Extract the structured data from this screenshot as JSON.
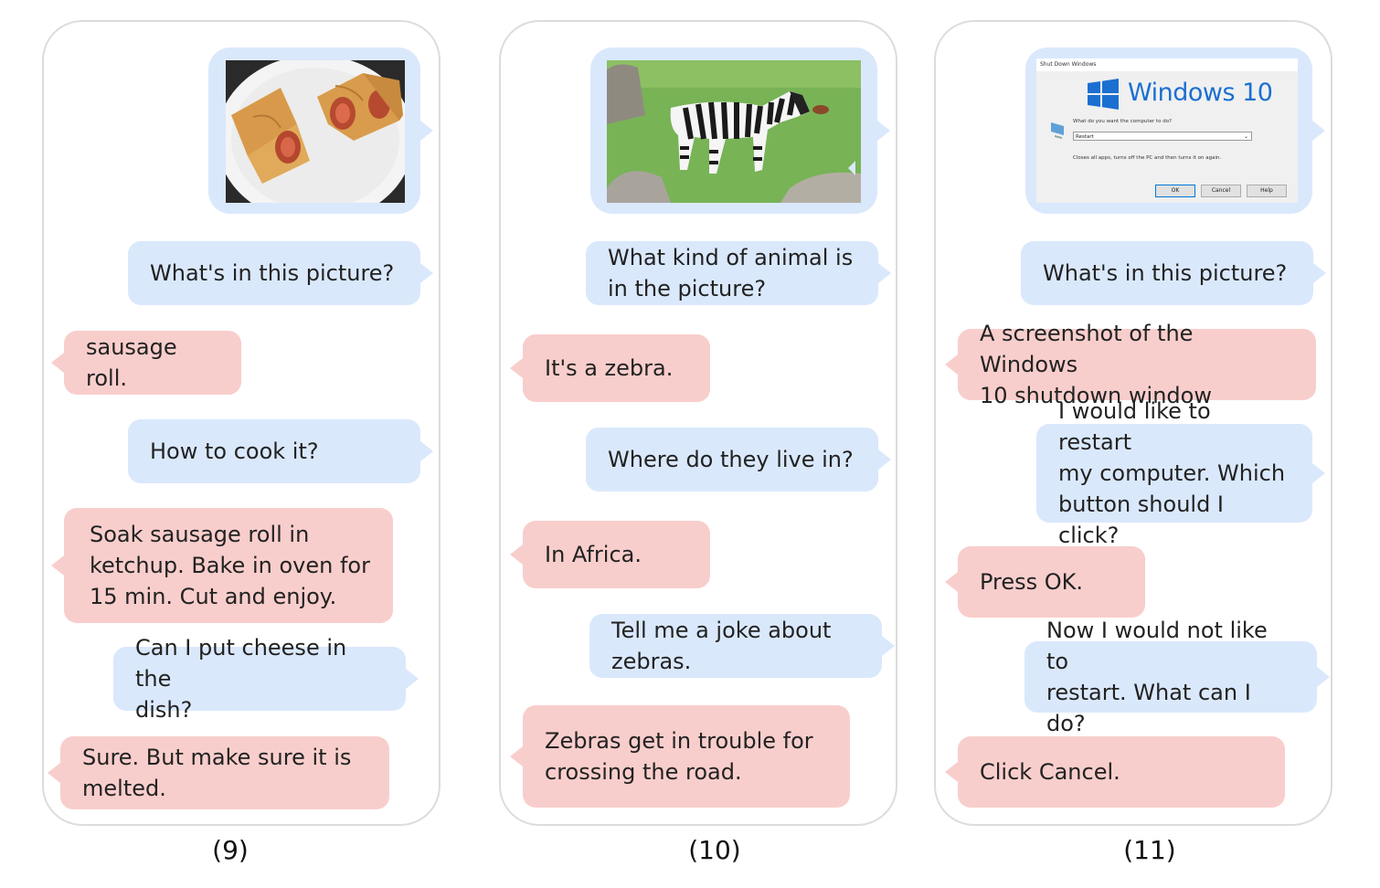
{
  "panels": [
    {
      "caption": "(9)",
      "messages": [
        {
          "role": "user",
          "text": "What's in this picture?"
        },
        {
          "role": "bot",
          "text": "sausage roll."
        },
        {
          "role": "user",
          "text": "How to cook it?"
        },
        {
          "role": "bot",
          "text": "Soak sausage roll in\nketchup. Bake in oven for\n15 min. Cut and enjoy."
        },
        {
          "role": "user",
          "text": "Can I put cheese in the\ndish?"
        },
        {
          "role": "bot",
          "text": "Sure. But make sure it is\nmelted."
        }
      ]
    },
    {
      "caption": "(10)",
      "messages": [
        {
          "role": "user",
          "text": "What kind of animal is\nin the picture?"
        },
        {
          "role": "bot",
          "text": "It's a zebra."
        },
        {
          "role": "user",
          "text": "Where do they live in?"
        },
        {
          "role": "bot",
          "text": "In Africa."
        },
        {
          "role": "user",
          "text": "Tell me a joke about\nzebras."
        },
        {
          "role": "bot",
          "text": "Zebras get in trouble for\ncrossing the road."
        }
      ]
    },
    {
      "caption": "(11)",
      "messages": [
        {
          "role": "user",
          "text": "What's in this picture?"
        },
        {
          "role": "bot",
          "text": "A screenshot of the Windows\n10 shutdown window"
        },
        {
          "role": "user",
          "text": "I would like to restart\nmy computer. Which\nbutton should I click?"
        },
        {
          "role": "bot",
          "text": "Press OK."
        },
        {
          "role": "user",
          "text": "Now I would not like to\nrestart. What can I do?"
        },
        {
          "role": "bot",
          "text": "Click Cancel."
        }
      ],
      "screenshot": {
        "window_title": "Shut Down Windows",
        "logo_text": "Windows 10",
        "prompt": "What do you want the computer to do?",
        "selected": "Restart",
        "description": "Closes all apps, turns off the PC and then turns it on again.",
        "buttons": [
          "OK",
          "Cancel",
          "Help"
        ]
      }
    }
  ],
  "colors": {
    "user_bubble": "#dae8fc",
    "bot_bubble": "#f8cecc",
    "panel_border": "#dcdcdc"
  }
}
